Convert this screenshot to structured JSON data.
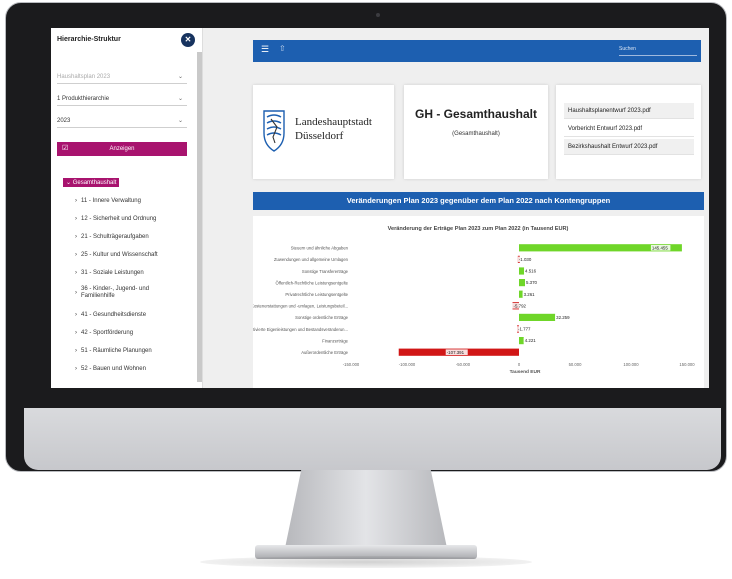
{
  "sidebar": {
    "title": "Hierarchie-Struktur",
    "selects": [
      {
        "value": "Haushaltsplan 2023",
        "disabled": true
      },
      {
        "value": "1 Produkthierarchie",
        "disabled": false
      },
      {
        "value": "2023",
        "disabled": false
      }
    ],
    "show_button": "Anzeigen",
    "tree_root": "Gesamthaushalt",
    "tree_items": [
      "11 - Innere Verwaltung",
      "12 - Sicherheit und Ordnung",
      "21 - Schulträgeraufgaben",
      "25 - Kultur und Wissenschaft",
      "31 - Soziale Leistungen",
      "36 - Kinder-, Jugend- und Familienhilfe",
      "41 - Gesundheitsdienste",
      "42 - Sportförderung",
      "51 - Räumliche Planungen",
      "52 - Bauen und Wohnen"
    ]
  },
  "topbar": {
    "search_placeholder": "Suchen",
    "menu_icon": "hamburger-icon",
    "share_icon": "share-icon"
  },
  "logo": {
    "line1": "Landeshauptstadt",
    "line2": "Düsseldorf"
  },
  "title_card": {
    "title": "GH - Gesamthaushalt",
    "subtitle": "(Gesamthaushalt)"
  },
  "files": [
    "Haushaltsplanentwurf 2023.pdf",
    "Vorbericht Entwurf 2023.pdf",
    "Bezirkshaushalt Entwurf 2023.pdf"
  ],
  "section_title": "Veränderungen Plan 2023 gegenüber dem Plan 2022 nach Kontengruppen",
  "colors": {
    "accent_magenta": "#a8136e",
    "brand_blue": "#1d5fb0",
    "positive": "#6fd629",
    "negative": "#d11616"
  },
  "chart_data": {
    "type": "bar",
    "orientation": "horizontal",
    "title": "Veränderung der Erträge Plan 2023 zum Plan 2022 (in Tausend EUR)",
    "xlabel": "Tausend EUR",
    "ylabel": "",
    "xlim": [
      -150000,
      150000
    ],
    "ticks": [
      "-150.000",
      "-100.000",
      "-50.000",
      "0",
      "50.000",
      "100.000",
      "150.000"
    ],
    "categories": [
      "Steuern und ähnliche Abgaben",
      "Zuwendungen und allgemeine Umlagen",
      "Sonstige Transfererträge",
      "Öffentlich-Rechtliche Leistungsentgelte",
      "Privatrechtliche Leistungsentgelte",
      "Kostenerstattungen und -umlagen, Leistungsbeteil...",
      "Sonstige ordentliche Erträge",
      "Aktivierte Eigenleistungen und Bestandsveränderun...",
      "Finanzerträge",
      "Außerordentliche Erträge"
    ],
    "values": [
      145455,
      -1030,
      4516,
      5370,
      3261,
      -5792,
      32259,
      -1777,
      4221,
      -107391
    ],
    "labels": [
      "145.455",
      "-1.030",
      "4.516",
      "5.370",
      "3.261",
      "-5.792",
      "32.259",
      "-1.777",
      "4.221",
      "-107.391"
    ],
    "grid": false
  }
}
